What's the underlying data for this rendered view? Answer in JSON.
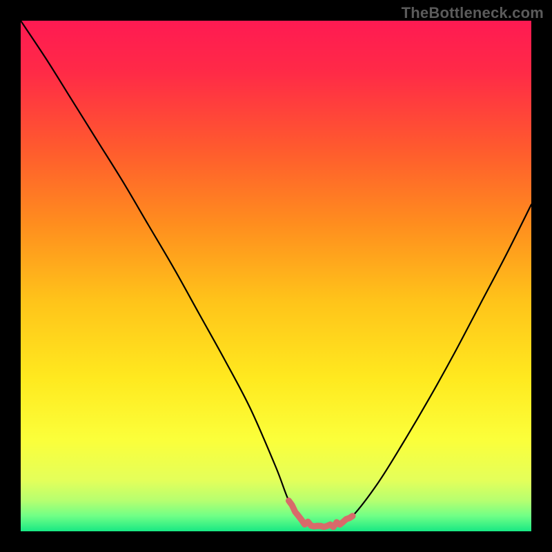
{
  "watermark": "TheBottleneck.com",
  "colors": {
    "background": "#000000",
    "gradient_stops": [
      {
        "offset": 0.0,
        "color": "#ff1a52"
      },
      {
        "offset": 0.1,
        "color": "#ff2a47"
      },
      {
        "offset": 0.25,
        "color": "#ff5a2e"
      },
      {
        "offset": 0.4,
        "color": "#ff8e1e"
      },
      {
        "offset": 0.55,
        "color": "#ffc41a"
      },
      {
        "offset": 0.7,
        "color": "#ffe91f"
      },
      {
        "offset": 0.82,
        "color": "#fbff3a"
      },
      {
        "offset": 0.9,
        "color": "#e4ff5a"
      },
      {
        "offset": 0.94,
        "color": "#b6ff70"
      },
      {
        "offset": 0.97,
        "color": "#70ff86"
      },
      {
        "offset": 1.0,
        "color": "#18e884"
      }
    ],
    "curve_stroke": "#000000",
    "highlight_stroke": "#d86a6a"
  },
  "chart_data": {
    "type": "line",
    "title": "",
    "xlabel": "",
    "ylabel": "",
    "xlim": [
      0,
      1
    ],
    "ylim": [
      0,
      1
    ],
    "series": [
      {
        "name": "bottleneck-curve",
        "x": [
          0.0,
          0.05,
          0.1,
          0.15,
          0.2,
          0.25,
          0.3,
          0.35,
          0.4,
          0.45,
          0.5,
          0.525,
          0.55,
          0.575,
          0.6,
          0.625,
          0.65,
          0.7,
          0.75,
          0.8,
          0.85,
          0.9,
          0.95,
          1.0
        ],
        "y": [
          1.0,
          0.925,
          0.845,
          0.765,
          0.685,
          0.6,
          0.515,
          0.425,
          0.335,
          0.24,
          0.125,
          0.06,
          0.02,
          0.01,
          0.01,
          0.015,
          0.03,
          0.095,
          0.175,
          0.26,
          0.35,
          0.445,
          0.54,
          0.64
        ]
      }
    ],
    "highlight_segment": {
      "series": "bottleneck-curve",
      "x_start": 0.525,
      "x_end": 0.65,
      "style": "thick-red-squiggle"
    }
  }
}
